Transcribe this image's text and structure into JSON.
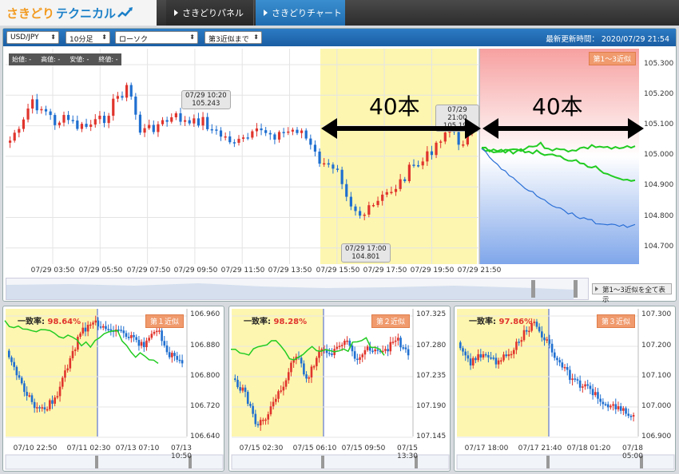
{
  "app": {
    "logo_part1": "さきどり",
    "logo_part2": "テクニカル"
  },
  "nav": {
    "tabs": [
      {
        "label": "さきどりパネル"
      },
      {
        "label": "さきどりチャート"
      }
    ]
  },
  "toolbar": {
    "pair": "USD/JPY",
    "timeframe": "10分足",
    "chart_style": "ローソク",
    "similarity": "第3近似まで",
    "last_updated": "最新更新時間： 2020/07/29 21:54"
  },
  "main": {
    "ohlc_labels": [
      "始値: -",
      "高値: -",
      "安値: -",
      "終値: -"
    ],
    "y_ticks": [
      "105.300",
      "105.200",
      "105.100",
      "105.000",
      "104.900",
      "104.800",
      "104.700"
    ],
    "x_ticks": [
      "07/29 03:50",
      "07/29 05:50",
      "07/29 07:50",
      "07/29 09:50",
      "07/29 11:50",
      "07/29 13:50",
      "07/29 15:50",
      "07/29 17:50",
      "07/29 19:50",
      "07/29 21:50"
    ],
    "forecast_badge": "第1〜3近似",
    "bars_label": "40本",
    "tooltips": [
      {
        "time": "07/29 10:20",
        "price": "105.243"
      },
      {
        "time": "07/29 21:00",
        "price": "105.196"
      },
      {
        "time": "07/29 17:00",
        "price": "104.801"
      }
    ],
    "show_all_button": "第1〜3近似を全て表示"
  },
  "subcharts": [
    {
      "match_label": "一致率:",
      "match_value": "98.64%",
      "badge": "第１近似",
      "y_ticks": [
        "106.960",
        "106.880",
        "106.800",
        "106.720",
        "106.640"
      ],
      "x_ticks": [
        "07/10 22:50",
        "07/11 02:30",
        "07/13 07:10",
        "07/13 10:50"
      ]
    },
    {
      "match_label": "一致率:",
      "match_value": "98.28%",
      "badge": "第２近似",
      "y_ticks": [
        "107.325",
        "107.280",
        "107.235",
        "107.190",
        "107.145"
      ],
      "x_ticks": [
        "07/15 02:30",
        "07/15 06:10",
        "07/15 09:50",
        "07/15 13:30"
      ]
    },
    {
      "match_label": "一致率:",
      "match_value": "97.86%",
      "badge": "第３近似",
      "y_ticks": [
        "107.300",
        "107.200",
        "107.100",
        "107.000",
        "106.900"
      ],
      "x_ticks": [
        "07/17 18:00",
        "07/17 21:40",
        "07/18 01:20",
        "07/18 05:00"
      ]
    }
  ],
  "colors": {
    "up": "#e0342c",
    "down": "#1f6fd0",
    "forecast": "#22cc22",
    "highlight": "#fdf6b0",
    "brand_blue": "#1a7fc8",
    "brand_orange": "#f29a1f"
  }
}
